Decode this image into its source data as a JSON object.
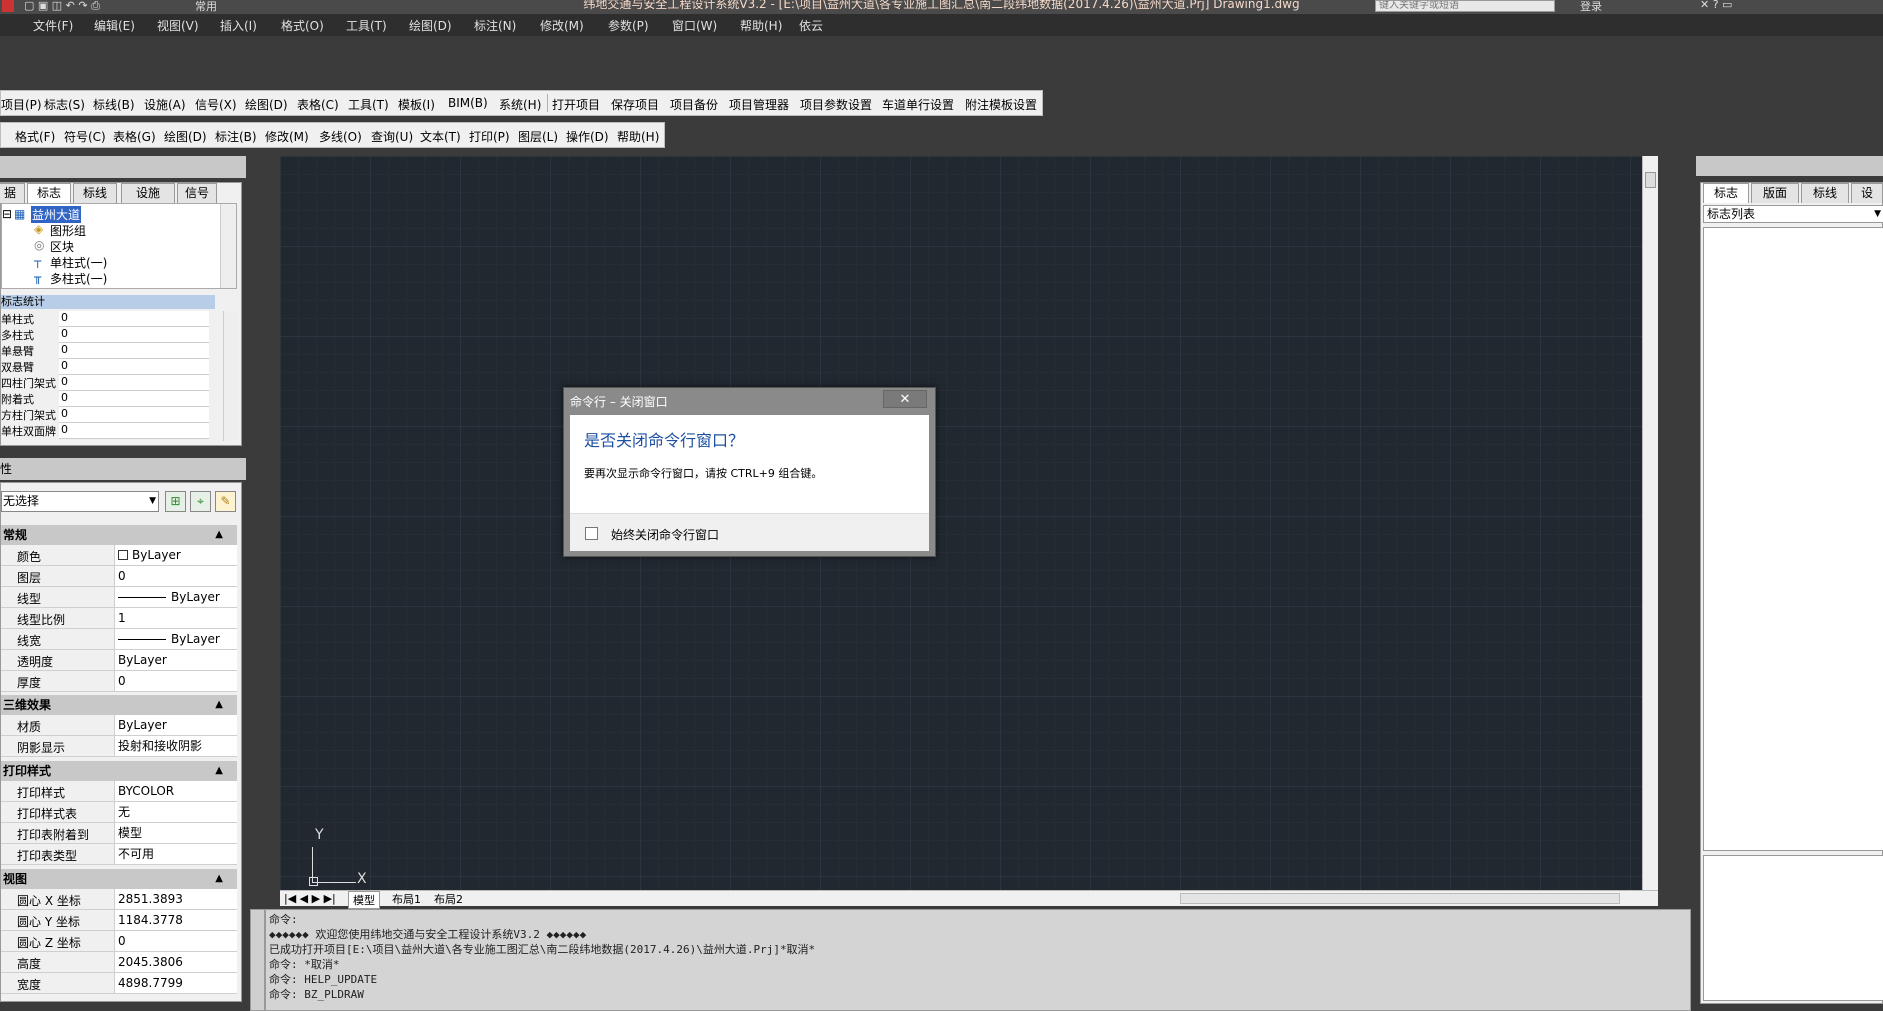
{
  "titlebar": {
    "title": "纬地交通与安全工程设计系统V3.2 - [E:\\项目\\益州大道\\各专业施工图汇总\\南二段纬地数据(2017.4.26)\\益州大道.Prj]    Drawing1.dwg",
    "search_placeholder": "键入关键字或短语",
    "signin": "登录",
    "workspace": "常用"
  },
  "menubar": [
    "文件(F)",
    "编辑(E)",
    "视图(V)",
    "插入(I)",
    "格式(O)",
    "工具(T)",
    "绘图(D)",
    "标注(N)",
    "修改(M)",
    "参数(P)",
    "窗口(W)",
    "帮助(H)",
    "依云"
  ],
  "toolbar1": [
    "项目(P)",
    "标志(S)",
    "标线(B)",
    "设施(A)",
    "信号(X)",
    "绘图(D)",
    "表格(C)",
    "工具(T)",
    "模板(I)",
    "BIM(B)",
    "系统(H)",
    "打开项目",
    "保存项目",
    "项目备份",
    "项目管理器",
    "项目参数设置",
    "车道单行设置",
    "附注模板设置"
  ],
  "toolbar2": [
    "格式(F)",
    "符号(C)",
    "表格(G)",
    "绘图(D)",
    "标注(B)",
    "修改(M)",
    "多线(O)",
    "查询(U)",
    "文本(T)",
    "打印(P)",
    "图层(L)",
    "操作(D)",
    "帮助(H)"
  ],
  "left_tabs": [
    "据",
    "标志",
    "标线",
    "设施",
    "信号"
  ],
  "tree": [
    "益州大道",
    "图形组",
    "区块",
    "单柱式(一)",
    "多柱式(一)"
  ],
  "stats": {
    "header": "标志统计",
    "rows": [
      {
        "k": "单柱式",
        "v": "0"
      },
      {
        "k": "多柱式",
        "v": "0"
      },
      {
        "k": "单悬臂",
        "v": "0"
      },
      {
        "k": "双悬臂",
        "v": "0"
      },
      {
        "k": "四柱门架式",
        "v": "0"
      },
      {
        "k": "附着式",
        "v": "0"
      },
      {
        "k": "方柱门架式",
        "v": "0"
      },
      {
        "k": "单柱双面牌",
        "v": "0"
      }
    ]
  },
  "properties": {
    "title": "性",
    "selection": "无选择",
    "sections": [
      {
        "name": "常规",
        "rows": [
          {
            "k": "颜色",
            "v": "ByLayer"
          },
          {
            "k": "图层",
            "v": "0"
          },
          {
            "k": "线型",
            "v": "ByLayer"
          },
          {
            "k": "线型比例",
            "v": "1"
          },
          {
            "k": "线宽",
            "v": "ByLayer"
          },
          {
            "k": "透明度",
            "v": "ByLayer"
          },
          {
            "k": "厚度",
            "v": "0"
          }
        ]
      },
      {
        "name": "三维效果",
        "rows": [
          {
            "k": "材质",
            "v": "ByLayer"
          },
          {
            "k": "阴影显示",
            "v": "投射和接收阴影"
          }
        ]
      },
      {
        "name": "打印样式",
        "rows": [
          {
            "k": "打印样式",
            "v": "BYCOLOR"
          },
          {
            "k": "打印样式表",
            "v": "无"
          },
          {
            "k": "打印表附着到",
            "v": "模型"
          },
          {
            "k": "打印表类型",
            "v": "不可用"
          }
        ]
      },
      {
        "name": "视图",
        "rows": [
          {
            "k": "圆心 X 坐标",
            "v": "2851.3893"
          },
          {
            "k": "圆心 Y 坐标",
            "v": "1184.3778"
          },
          {
            "k": "圆心 Z 坐标",
            "v": "0"
          },
          {
            "k": "高度",
            "v": "2045.3806"
          },
          {
            "k": "宽度",
            "v": "4898.7799"
          }
        ]
      }
    ]
  },
  "layout_tabs": [
    "模型",
    "布局1",
    "布局2"
  ],
  "ucs": {
    "x": "X",
    "y": "Y"
  },
  "dialog": {
    "caption": "命令行 – 关闭窗口",
    "close": "✕",
    "heading": "是否关闭命令行窗口？",
    "message": "要再次显示命令行窗口，请按 CTRL+9 组合键。",
    "checkbox": "始终关闭命令行窗口"
  },
  "command": [
    "命令:",
    "◆◆◆◆◆◆ 欢迎您使用纬地交通与安全工程设计系统V3.2 ◆◆◆◆◆◆",
    "已成功打开项目[E:\\项目\\益州大道\\各专业施工图汇总\\南二段纬地数据(2017.4.26)\\益州大道.Prj]*取消*",
    "命令: *取消*",
    "命令: HELP_UPDATE",
    "命令: BZ_PLDRAW"
  ],
  "right_tabs": [
    "标志",
    "版面",
    "标线",
    "设"
  ],
  "right_combo": "标志列表"
}
